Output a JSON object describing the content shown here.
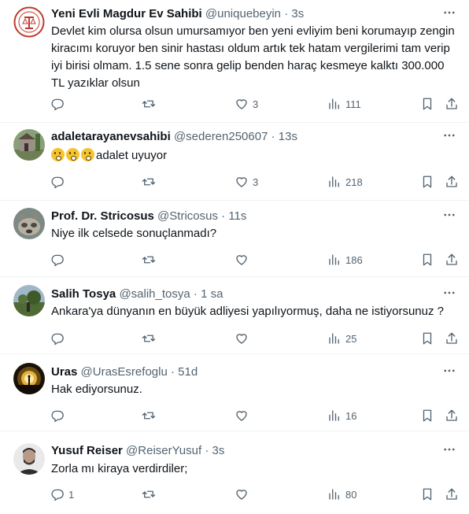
{
  "tweets": [
    {
      "name": "Yeni Evli Magdur Ev Sahibi",
      "handle": "@uniquebeyin",
      "dot": "·",
      "time": "3s",
      "text": "Devlet kim olursa olsun umursamıyor ben yeni evliyim beni korumayıp zengin kiracımı koruyor ben sinir hastası oldum artık tek hatam vergilerimi tam verip iyi birisi olmam. 1.5 sene sonra gelip benden haraç kesmeye kalktı 300.000 TL yazıklar olsun",
      "replies": "",
      "retweets": "",
      "likes": "3",
      "views": "111",
      "avatar": "seal-logo-avatar"
    },
    {
      "name": "adaletarayanevsahibi",
      "handle": "@sederen250607",
      "dot": "·",
      "time": "13s",
      "text": "adalet uyuyor",
      "emoji": "sleeping-face-emoji",
      "emoji_count": 3,
      "replies": "",
      "retweets": "",
      "likes": "3",
      "views": "218",
      "avatar": "house-photo-avatar"
    },
    {
      "name": "Prof. Dr. Stricosus",
      "handle": "@Stricosus",
      "dot": "·",
      "time": "11s",
      "text": "Niye ilk celsede sonuçlanmadı?",
      "replies": "",
      "retweets": "",
      "likes": "",
      "views": "186",
      "avatar": "dog-photo-avatar"
    },
    {
      "name": "Salih Tosya",
      "handle": "@salih_tosya",
      "dot": "·",
      "time": "1 sa",
      "text": "Ankara'ya dünyanın en büyük adliyesi yapılıyormuş, daha ne istiyorsunuz ?",
      "replies": "",
      "retweets": "",
      "likes": "",
      "views": "25",
      "avatar": "landscape-photo-avatar"
    },
    {
      "name": "Uras",
      "handle": "@UrasEsrefoglu",
      "dot": "·",
      "time": "51d",
      "text": "Hak ediyorsunuz.",
      "replies": "",
      "retweets": "",
      "likes": "",
      "views": "16",
      "avatar": "sunset-silhouette-avatar"
    },
    {
      "name": "Yusuf Reiser",
      "handle": "@ReiserYusuf",
      "dot": "·",
      "time": "3s",
      "text": "Zorla mı kiraya verdirdiler;",
      "replies": "1",
      "retweets": "",
      "likes": "",
      "views": "80",
      "avatar": "person-photo-avatar"
    }
  ],
  "icons": {
    "reply": "reply-icon",
    "retweet": "retweet-icon",
    "like": "heart-icon",
    "views": "views-chart-icon",
    "bookmark": "bookmark-icon",
    "share": "share-icon",
    "more": "more-dots-icon"
  },
  "colors": {
    "text": "#0f1419",
    "secondary": "#536471",
    "divider": "#eff3f4",
    "background": "#ffffff"
  }
}
